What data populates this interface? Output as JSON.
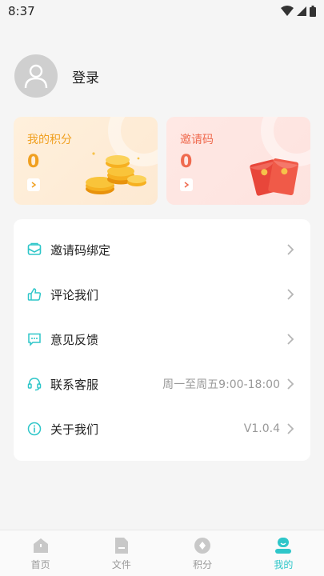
{
  "status_bar": {
    "time": "8:37"
  },
  "profile": {
    "login_label": "登录"
  },
  "cards": {
    "points": {
      "title": "我的积分",
      "value": "0"
    },
    "invite": {
      "title": "邀请码",
      "value": "0"
    }
  },
  "menu": {
    "items": [
      {
        "label": "邀请码绑定",
        "icon": "envelope-icon",
        "value": ""
      },
      {
        "label": "评论我们",
        "icon": "thumbs-up-icon",
        "value": ""
      },
      {
        "label": "意见反馈",
        "icon": "feedback-icon",
        "value": ""
      },
      {
        "label": "联系客服",
        "icon": "headset-icon",
        "value": "周一至周五9:00-18:00"
      },
      {
        "label": "关于我们",
        "icon": "info-icon",
        "value": "V1.0.4"
      }
    ]
  },
  "tabbar": {
    "tabs": [
      {
        "label": "首页",
        "icon": "home-icon",
        "active": false
      },
      {
        "label": "文件",
        "icon": "file-icon",
        "active": false
      },
      {
        "label": "积分",
        "icon": "points-icon",
        "active": false
      },
      {
        "label": "我的",
        "icon": "profile-icon",
        "active": true
      }
    ]
  },
  "colors": {
    "accent": "#2ec6c9",
    "points_orange": "#f0a020",
    "invite_red": "#ef6a4e",
    "background": "#f5f5f5"
  }
}
